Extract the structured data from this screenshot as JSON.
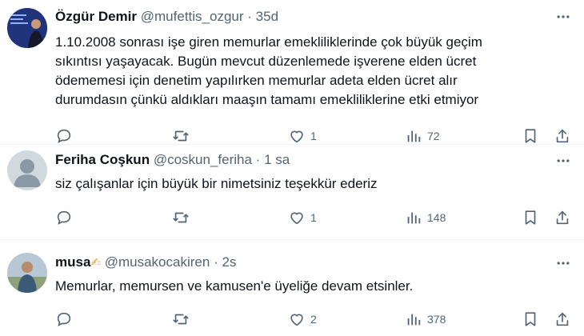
{
  "tweets": [
    {
      "author": "Özgür Demir",
      "handle": "@mufettis_ozgur",
      "separator": "·",
      "time": "35d",
      "lines": [
        "1.10.2008 sonrası işe giren memurlar emekliliklerinde çok büyük geçim",
        "sıkıntısı yaşayacak. Bugün mevcut düzenlemede işverene elden ücret",
        "ödememesi için denetim yapılırken memurlar adeta elden ücret alır",
        "durumdasın çünkü aldıkları maaşın tamamı emekliliklerine etki etmiyor"
      ],
      "likes": "1",
      "views": "72"
    },
    {
      "author": "Feriha Coşkun",
      "handle": "@coskun_feriha",
      "separator": "·",
      "time": "1 sa",
      "lines": [
        "siz çalışanlar için büyük bir nimetsiniz teşekkür ederiz"
      ],
      "likes": "1",
      "views": "148"
    },
    {
      "author": "musa",
      "author_emoji": "✍",
      "handle": "@musakocakiren",
      "separator": "·",
      "time": "2s",
      "lines": [
        "Memurlar, memursen ve kamusen'e üyeliğe devam etsinler."
      ],
      "likes": "2",
      "views": "378"
    }
  ],
  "icons": {
    "reply": "reply-icon",
    "retweet": "retweet-icon",
    "like": "like-icon",
    "views": "views-icon",
    "bookmark": "bookmark-icon",
    "share": "share-icon",
    "more": "more-icon"
  },
  "colors": {
    "text": "#0f1419",
    "secondary": "#536471",
    "divider": "#eff3f4"
  }
}
